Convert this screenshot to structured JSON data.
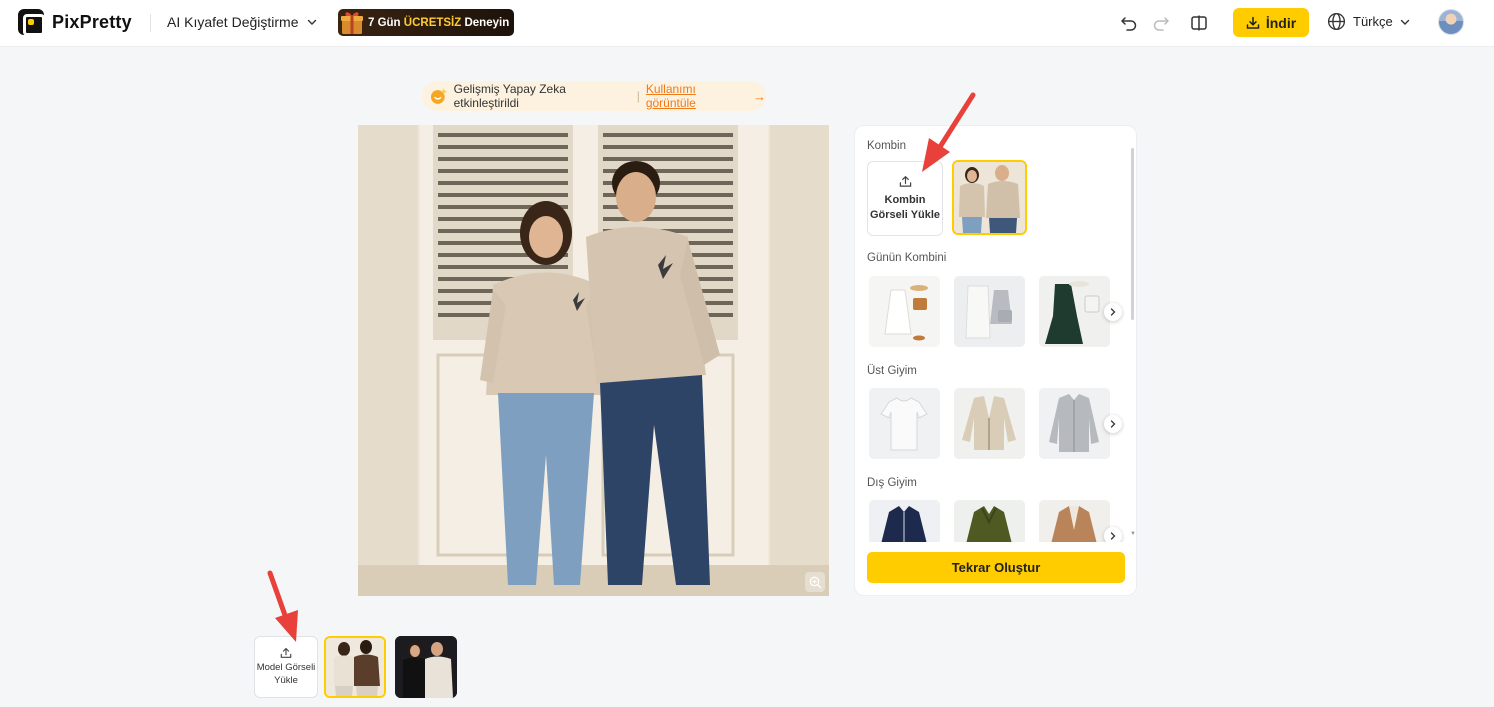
{
  "header": {
    "brand": "PixPretty",
    "tool_name": "AI Kıyafet Değiştirme",
    "promo": {
      "prefix": "7 Gün ",
      "highlight": "ÜCRETSİZ",
      "suffix": " Deneyin"
    },
    "download_label": "İndir",
    "language": "Türkçe"
  },
  "ai_banner": {
    "text": "Gelişmiş Yapay Zeka etkinleştirildi",
    "separator": "|",
    "link": "Kullanımı görüntüle",
    "arrow": "→"
  },
  "panel": {
    "outfit_title": "Kombin",
    "upload_outfit_label": "Kombin Görseli Yükle",
    "sections": [
      {
        "title": "Günün Kombini"
      },
      {
        "title": "Üst Giyim"
      },
      {
        "title": "Dış Giyim"
      }
    ],
    "regenerate_label": "Tekrar Oluştur"
  },
  "bottom": {
    "upload_model_label": "Model Görseli Yükle"
  },
  "colors": {
    "accent": "#ffcc00",
    "link": "#f07a1a",
    "annotation_arrow": "#e8403a"
  },
  "icons": {
    "undo": "undo-icon",
    "redo": "redo-icon",
    "compare": "compare-icon",
    "download": "download-icon",
    "globe": "globe-icon",
    "upload": "upload-icon",
    "zoom": "zoom-icon",
    "chevron": "chevron-right-icon"
  }
}
